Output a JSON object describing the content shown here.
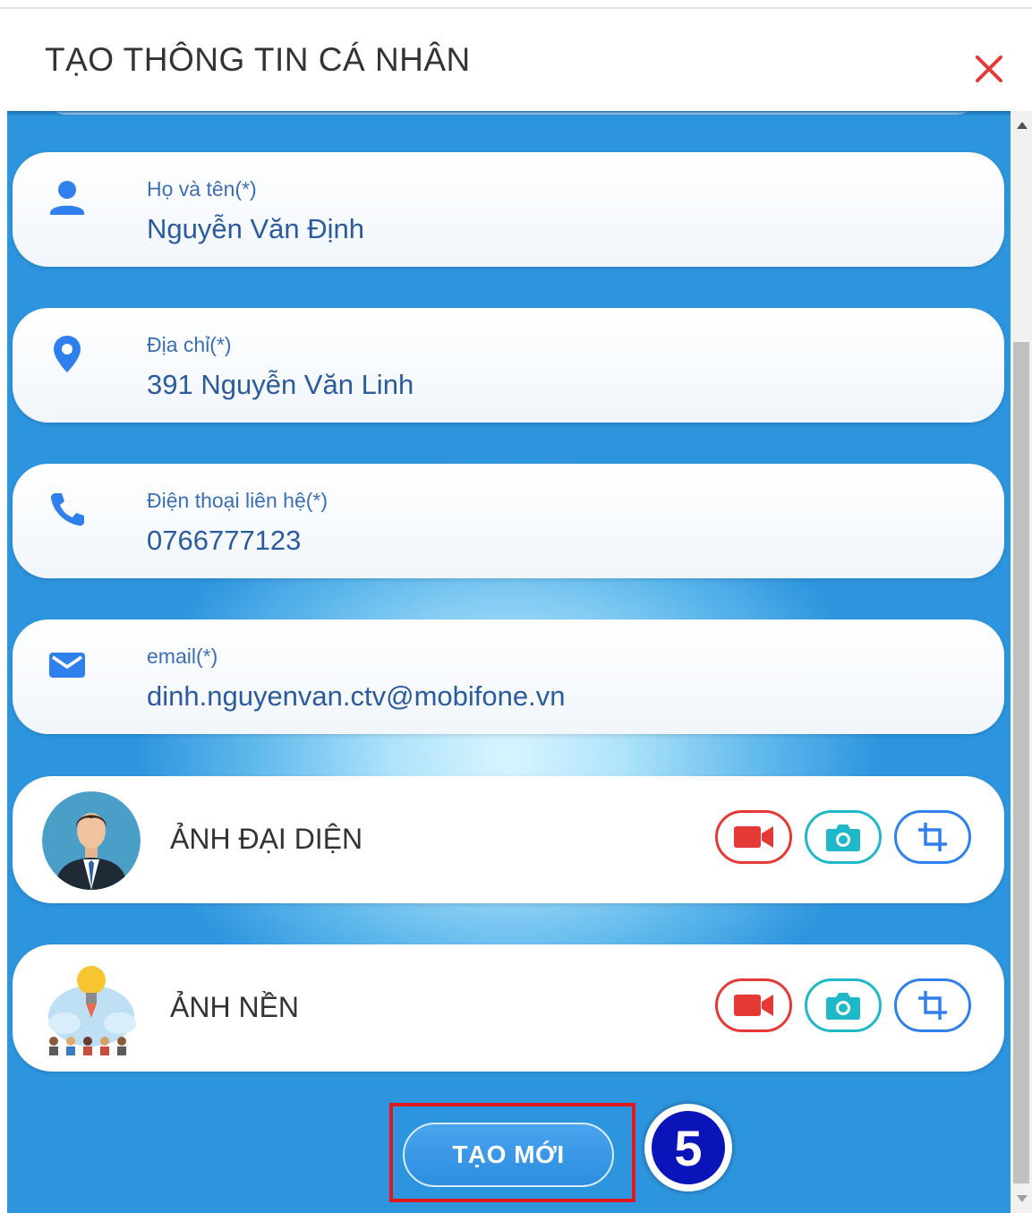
{
  "header": {
    "title": "TẠO THÔNG TIN CÁ NHÂN",
    "close_icon": "close-icon",
    "close_color": "#e53935"
  },
  "form": {
    "fields": [
      {
        "label": "Họ và tên(*)",
        "value": "Nguyễn Văn Định",
        "icon": "person-icon"
      },
      {
        "label": "Địa chỉ(*)",
        "value": "391 Nguyễn Văn Linh",
        "icon": "location-pin-icon"
      },
      {
        "label": "Điện thoại liên hệ(*)",
        "value": "0766777123",
        "icon": "phone-icon"
      },
      {
        "label": "email(*)",
        "value": "dinh.nguyenvan.ctv@mobifone.vn",
        "icon": "mail-icon"
      }
    ],
    "photos": [
      {
        "label": "ẢNH ĐẠI DIỆN",
        "thumbnail": "avatar-businessman",
        "actions": [
          "video-icon",
          "camera-icon",
          "crop-icon"
        ]
      },
      {
        "label": "ẢNH NỀN",
        "thumbnail": "background-lightbulb-team",
        "actions": [
          "video-icon",
          "camera-icon",
          "crop-icon"
        ]
      }
    ],
    "submit_label": "TẠO MỚI",
    "step_number": "5"
  },
  "colors": {
    "accent_blue": "#2d94de",
    "icon_blue": "#2f80ed",
    "video_red": "#e53935",
    "camera_cyan": "#1fb8c9",
    "highlight_red": "#e0191e",
    "step_badge": "#0a14b8"
  }
}
